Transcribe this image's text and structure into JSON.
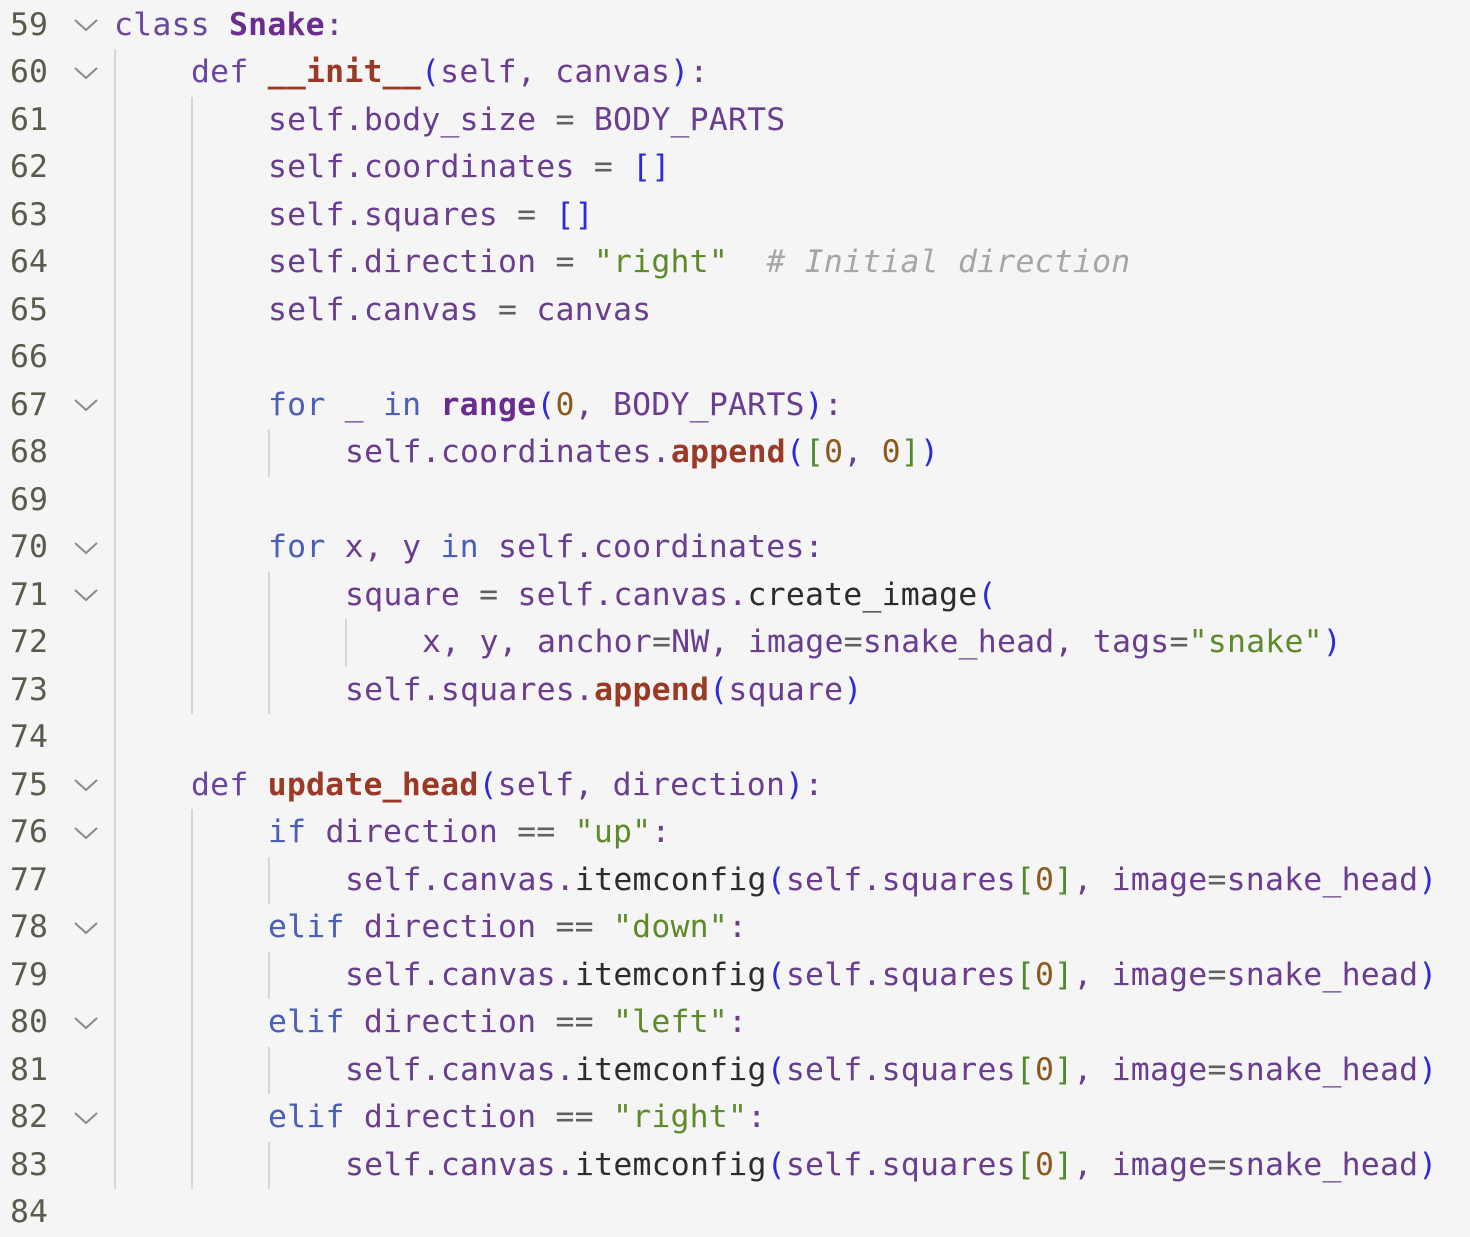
{
  "editor": {
    "language": "python",
    "lines": [
      {
        "n": "59",
        "fold": true,
        "indent": 0,
        "tokens": [
          [
            "kw",
            "class "
          ],
          [
            "cls",
            "Snake"
          ],
          [
            "pn",
            ":"
          ]
        ]
      },
      {
        "n": "60",
        "fold": true,
        "indent": 1,
        "tokens": [
          [
            "kw",
            "def "
          ],
          [
            "fn",
            "__init__"
          ],
          [
            "b1",
            "("
          ],
          [
            "var",
            "self, canvas"
          ],
          [
            "b1",
            ")"
          ],
          [
            "pn",
            ":"
          ]
        ]
      },
      {
        "n": "61",
        "fold": false,
        "indent": 2,
        "tokens": [
          [
            "var",
            "self.body_size "
          ],
          [
            "op",
            "= "
          ],
          [
            "var",
            "BODY_PARTS"
          ]
        ]
      },
      {
        "n": "62",
        "fold": false,
        "indent": 2,
        "tokens": [
          [
            "var",
            "self.coordinates "
          ],
          [
            "op",
            "= "
          ],
          [
            "b1",
            "[]"
          ]
        ]
      },
      {
        "n": "63",
        "fold": false,
        "indent": 2,
        "tokens": [
          [
            "var",
            "self.squares "
          ],
          [
            "op",
            "= "
          ],
          [
            "b1",
            "[]"
          ]
        ]
      },
      {
        "n": "64",
        "fold": false,
        "indent": 2,
        "tokens": [
          [
            "var",
            "self.direction "
          ],
          [
            "op",
            "= "
          ],
          [
            "str",
            "\"right\""
          ],
          [
            "cmt",
            "  # Initial direction"
          ]
        ]
      },
      {
        "n": "65",
        "fold": false,
        "indent": 2,
        "tokens": [
          [
            "var",
            "self.canvas "
          ],
          [
            "op",
            "= "
          ],
          [
            "var",
            "canvas"
          ]
        ]
      },
      {
        "n": "66",
        "fold": false,
        "indent": 2,
        "tokens": []
      },
      {
        "n": "67",
        "fold": true,
        "indent": 2,
        "tokens": [
          [
            "ctrl",
            "for "
          ],
          [
            "var",
            "_ "
          ],
          [
            "ctrl",
            "in "
          ],
          [
            "cls",
            "range"
          ],
          [
            "b1",
            "("
          ],
          [
            "num",
            "0"
          ],
          [
            "var",
            ", BODY_PARTS"
          ],
          [
            "b1",
            ")"
          ],
          [
            "pn",
            ":"
          ]
        ]
      },
      {
        "n": "68",
        "fold": false,
        "indent": 3,
        "tokens": [
          [
            "var",
            "self.coordinates."
          ],
          [
            "fn",
            "append"
          ],
          [
            "b1",
            "("
          ],
          [
            "b2",
            "["
          ],
          [
            "num",
            "0"
          ],
          [
            "var",
            ", "
          ],
          [
            "num",
            "0"
          ],
          [
            "b2",
            "]"
          ],
          [
            "b1",
            ")"
          ]
        ]
      },
      {
        "n": "69",
        "fold": false,
        "indent": 2,
        "tokens": []
      },
      {
        "n": "70",
        "fold": true,
        "indent": 2,
        "tokens": [
          [
            "ctrl",
            "for "
          ],
          [
            "var",
            "x, y "
          ],
          [
            "ctrl",
            "in "
          ],
          [
            "var",
            "self.coordinates"
          ],
          [
            "pn",
            ":"
          ]
        ]
      },
      {
        "n": "71",
        "fold": true,
        "indent": 3,
        "tokens": [
          [
            "var",
            "square "
          ],
          [
            "op",
            "= "
          ],
          [
            "var",
            "self.canvas."
          ],
          [
            "call",
            "create_image"
          ],
          [
            "b1",
            "("
          ]
        ]
      },
      {
        "n": "72",
        "fold": false,
        "indent": 4,
        "tokens": [
          [
            "var",
            "x, y, anchor"
          ],
          [
            "op",
            "="
          ],
          [
            "var",
            "NW, image"
          ],
          [
            "op",
            "="
          ],
          [
            "var",
            "snake_head, tags"
          ],
          [
            "op",
            "="
          ],
          [
            "str",
            "\"snake\""
          ],
          [
            "b1",
            ")"
          ]
        ]
      },
      {
        "n": "73",
        "fold": false,
        "indent": 3,
        "tokens": [
          [
            "var",
            "self.squares."
          ],
          [
            "fn",
            "append"
          ],
          [
            "b1",
            "("
          ],
          [
            "var",
            "square"
          ],
          [
            "b1",
            ")"
          ]
        ]
      },
      {
        "n": "74",
        "fold": false,
        "indent": 1,
        "tokens": []
      },
      {
        "n": "75",
        "fold": true,
        "indent": 1,
        "tokens": [
          [
            "kw",
            "def "
          ],
          [
            "fn",
            "update_head"
          ],
          [
            "b1",
            "("
          ],
          [
            "var",
            "self, direction"
          ],
          [
            "b1",
            ")"
          ],
          [
            "pn",
            ":"
          ]
        ]
      },
      {
        "n": "76",
        "fold": true,
        "indent": 2,
        "tokens": [
          [
            "ctrl",
            "if "
          ],
          [
            "var",
            "direction "
          ],
          [
            "op",
            "== "
          ],
          [
            "str",
            "\"up\""
          ],
          [
            "pn",
            ":"
          ]
        ]
      },
      {
        "n": "77",
        "fold": false,
        "indent": 3,
        "tokens": [
          [
            "var",
            "self.canvas."
          ],
          [
            "call",
            "itemconfig"
          ],
          [
            "b1",
            "("
          ],
          [
            "var",
            "self.squares"
          ],
          [
            "b2",
            "["
          ],
          [
            "num",
            "0"
          ],
          [
            "b2",
            "]"
          ],
          [
            "var",
            ", image"
          ],
          [
            "op",
            "="
          ],
          [
            "var",
            "snake_head"
          ],
          [
            "b1",
            ")"
          ]
        ]
      },
      {
        "n": "78",
        "fold": true,
        "indent": 2,
        "tokens": [
          [
            "ctrl",
            "elif "
          ],
          [
            "var",
            "direction "
          ],
          [
            "op",
            "== "
          ],
          [
            "str",
            "\"down\""
          ],
          [
            "pn",
            ":"
          ]
        ]
      },
      {
        "n": "79",
        "fold": false,
        "indent": 3,
        "tokens": [
          [
            "var",
            "self.canvas."
          ],
          [
            "call",
            "itemconfig"
          ],
          [
            "b1",
            "("
          ],
          [
            "var",
            "self.squares"
          ],
          [
            "b2",
            "["
          ],
          [
            "num",
            "0"
          ],
          [
            "b2",
            "]"
          ],
          [
            "var",
            ", image"
          ],
          [
            "op",
            "="
          ],
          [
            "var",
            "snake_head"
          ],
          [
            "b1",
            ")"
          ]
        ]
      },
      {
        "n": "80",
        "fold": true,
        "indent": 2,
        "tokens": [
          [
            "ctrl",
            "elif "
          ],
          [
            "var",
            "direction "
          ],
          [
            "op",
            "== "
          ],
          [
            "str",
            "\"left\""
          ],
          [
            "pn",
            ":"
          ]
        ]
      },
      {
        "n": "81",
        "fold": false,
        "indent": 3,
        "tokens": [
          [
            "var",
            "self.canvas."
          ],
          [
            "call",
            "itemconfig"
          ],
          [
            "b1",
            "("
          ],
          [
            "var",
            "self.squares"
          ],
          [
            "b2",
            "["
          ],
          [
            "num",
            "0"
          ],
          [
            "b2",
            "]"
          ],
          [
            "var",
            ", image"
          ],
          [
            "op",
            "="
          ],
          [
            "var",
            "snake_head"
          ],
          [
            "b1",
            ")"
          ]
        ]
      },
      {
        "n": "82",
        "fold": true,
        "indent": 2,
        "tokens": [
          [
            "ctrl",
            "elif "
          ],
          [
            "var",
            "direction "
          ],
          [
            "op",
            "== "
          ],
          [
            "str",
            "\"right\""
          ],
          [
            "pn",
            ":"
          ]
        ]
      },
      {
        "n": "83",
        "fold": false,
        "indent": 3,
        "tokens": [
          [
            "var",
            "self.canvas."
          ],
          [
            "call",
            "itemconfig"
          ],
          [
            "b1",
            "("
          ],
          [
            "var",
            "self.squares"
          ],
          [
            "b2",
            "["
          ],
          [
            "num",
            "0"
          ],
          [
            "b2",
            "]"
          ],
          [
            "var",
            ", image"
          ],
          [
            "op",
            "="
          ],
          [
            "var",
            "snake_head"
          ],
          [
            "b1",
            ")"
          ]
        ]
      },
      {
        "n": "84",
        "fold": false,
        "indent": 0,
        "tokens": []
      }
    ],
    "icons": {
      "fold": "chevron-down-icon"
    }
  }
}
